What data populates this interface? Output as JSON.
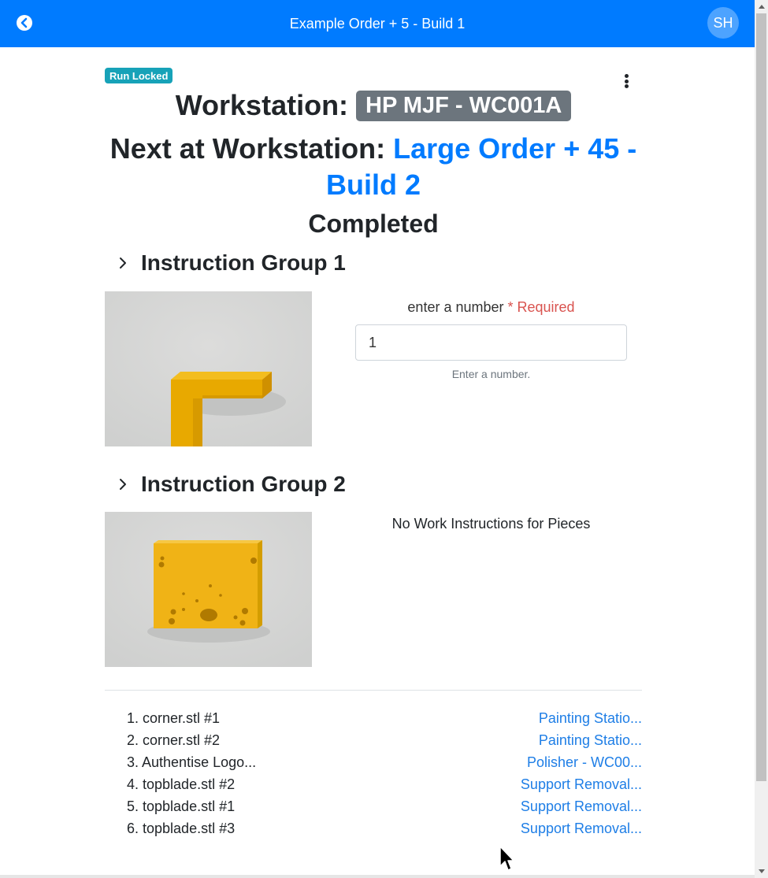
{
  "header": {
    "title": "Example Order + 5 - Build 1",
    "avatar_initials": "SH",
    "back_icon": "chevron-left-circle-icon",
    "bar_color": "#007bff"
  },
  "status": {
    "badge": "Run Locked",
    "badge_color": "#17a2b8"
  },
  "workstation": {
    "label": "Workstation:",
    "name": "HP MJF - WC001A"
  },
  "next": {
    "label": "Next at Workstation:",
    "link_text": "Large Order + 45 - Build 2"
  },
  "run_status": "Completed",
  "groups": [
    {
      "title": "Instruction Group 1",
      "field": {
        "label": "enter a number",
        "required": "* Required",
        "value": "1",
        "help": "Enter a number."
      }
    },
    {
      "title": "Instruction Group 2",
      "empty_text": "No Work Instructions for Pieces"
    }
  ],
  "pieces": [
    {
      "name": "1. corner.stl #1",
      "station": "Painting Statio..."
    },
    {
      "name": "2. corner.stl #2",
      "station": "Painting Statio..."
    },
    {
      "name": "3. Authentise Logo...",
      "station": "Polisher - WC00..."
    },
    {
      "name": "4. topblade.stl #2",
      "station": "Support Removal..."
    },
    {
      "name": "5. topblade.stl #1",
      "station": "Support Removal..."
    },
    {
      "name": "6. topblade.stl #3",
      "station": "Support Removal..."
    }
  ]
}
